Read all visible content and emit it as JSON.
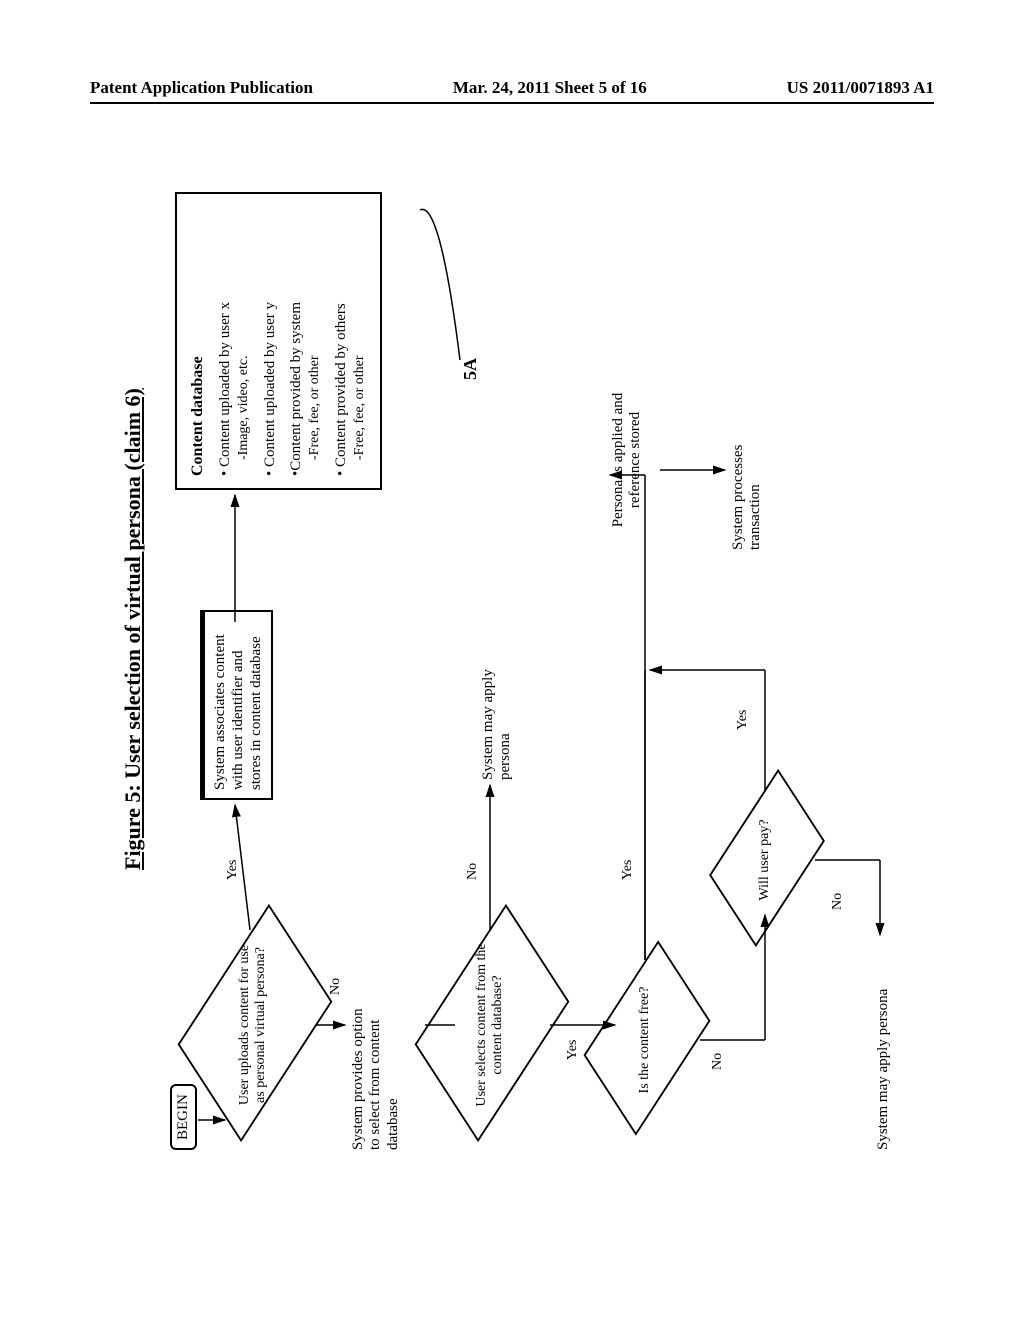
{
  "header": {
    "left": "Patent Application Publication",
    "center": "Mar. 24, 2011  Sheet 5 of 16",
    "right": "US 2011/0071893 A1"
  },
  "figure": {
    "title": "Figure 5: User selection of virtual persona (claim 6)",
    "begin": "BEGIN",
    "diamond_upload": "User uploads content for use as personal virtual persona?",
    "proc_assoc": "System associates content with user identifier and stores in content database",
    "db": {
      "header": "Content database",
      "item1": "Content uploaded by user x",
      "item1_sub": "-Image, video, etc.",
      "item2": "Content uploaded by user y",
      "item3": "Content provided by system",
      "item3_sub": "-Free, fee, or other",
      "item4": "Content provided by others",
      "item4_sub": "-Free, fee, or other"
    },
    "text_option": "System provides option to select from content database",
    "diamond_select": "User selects content from the content database?",
    "text_apply1": "System may apply persona",
    "diamond_free": "Is the content free?",
    "text_applied": "Persona is applied and reference stored",
    "diamond_pay": "Will user pay?",
    "text_tx": "System processes transaction",
    "text_apply2": "System may apply persona",
    "yes": "Yes",
    "no": "No",
    "fig_ref": "5A"
  }
}
